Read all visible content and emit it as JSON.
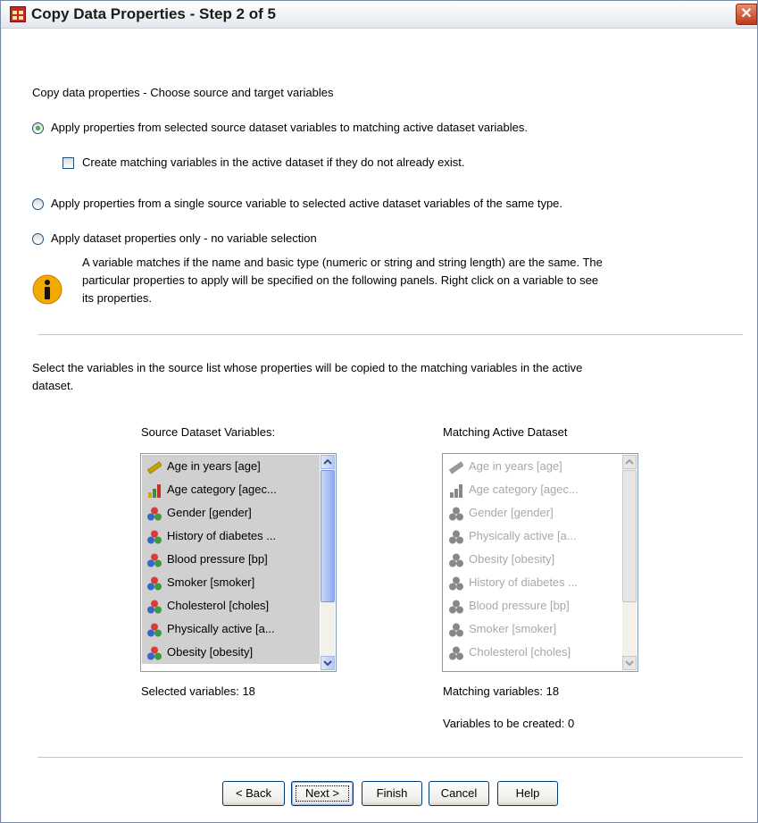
{
  "window": {
    "title": "Copy Data Properties - Step 2 of 5",
    "close_glyph": "✕"
  },
  "heading": "Copy data properties - Choose source and target variables",
  "options": {
    "apply_selected": "Apply properties from selected source dataset variables to matching active dataset variables.",
    "create_matching": "Create matching variables in the active dataset if they do not already  exist.",
    "apply_single": "Apply properties from a single source variable to selected active dataset variables of the same type.",
    "dataset_only": "Apply dataset properties only -  no variable selection"
  },
  "info_text": [
    "A variable matches if the name and basic type (numeric or string and string length) are the same. The",
    "particular properties to apply will be specified on the following panels. Right click on a variable to see",
    "its properties."
  ],
  "instruction": [
    "Select the variables in the source list whose properties will be copied to the matching variables in the active",
    "dataset."
  ],
  "source": {
    "label": "Source Dataset Variables:",
    "items": [
      {
        "label": "Age in years [age]",
        "icon": "scale-icon"
      },
      {
        "label": "Age category [agec...",
        "icon": "ordinal-icon"
      },
      {
        "label": "Gender [gender]",
        "icon": "nominal-icon"
      },
      {
        "label": "History of diabetes ...",
        "icon": "nominal-icon"
      },
      {
        "label": "Blood pressure [bp]",
        "icon": "nominal-icon"
      },
      {
        "label": "Smoker [smoker]",
        "icon": "nominal-icon"
      },
      {
        "label": "Cholesterol [choles]",
        "icon": "nominal-icon"
      },
      {
        "label": "Physically active [a...",
        "icon": "nominal-icon"
      },
      {
        "label": "Obesity [obesity]",
        "icon": "nominal-icon"
      }
    ],
    "status": "Selected variables: 18"
  },
  "matching": {
    "label": "Matching Active Dataset",
    "items": [
      {
        "label": "Age in years [age]",
        "icon": "scale-icon"
      },
      {
        "label": "Age category [agec...",
        "icon": "ordinal-icon"
      },
      {
        "label": "Gender [gender]",
        "icon": "nominal-icon"
      },
      {
        "label": "Physically active [a...",
        "icon": "nominal-icon"
      },
      {
        "label": "Obesity [obesity]",
        "icon": "nominal-icon"
      },
      {
        "label": "History of diabetes ...",
        "icon": "nominal-icon"
      },
      {
        "label": "Blood pressure [bp]",
        "icon": "nominal-icon"
      },
      {
        "label": "Smoker [smoker]",
        "icon": "nominal-icon"
      },
      {
        "label": "Cholesterol [choles]",
        "icon": "nominal-icon"
      }
    ],
    "status": "Matching variables: 18",
    "created": "Variables to be created: 0"
  },
  "buttons": {
    "back": "< Back",
    "next": "Next >",
    "finish": "Finish",
    "cancel": "Cancel",
    "help": "Help"
  },
  "colors": {
    "title_bar": "#e3e6ec",
    "close": "#c0391b",
    "info": "#f2a900",
    "list_select": "#d0d0d0"
  }
}
